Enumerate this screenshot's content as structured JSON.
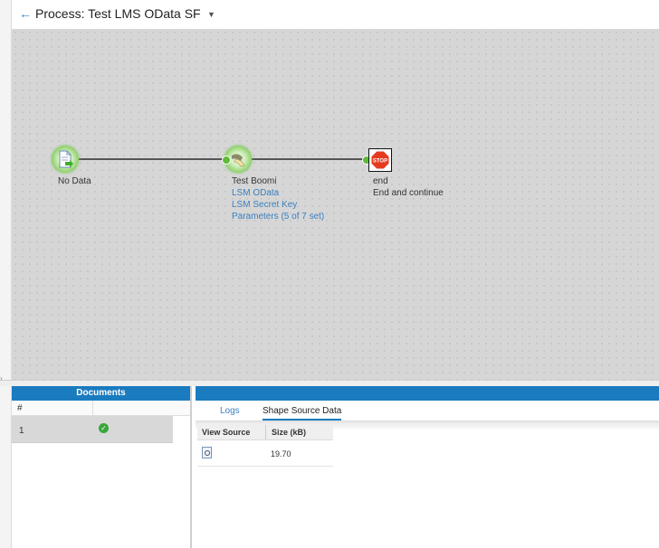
{
  "header": {
    "title": "Process: Test LMS OData SF"
  },
  "canvas": {
    "nodes": [
      {
        "title": "No Data",
        "lines": []
      },
      {
        "title": "Test Boomi",
        "lines": [
          "LSM OData",
          "LSM Secret Key",
          "Parameters (5 of 7 set)"
        ]
      },
      {
        "title": "end",
        "lines": [
          "End and continue"
        ]
      }
    ],
    "stop_text": "STOP"
  },
  "documents": {
    "title": "Documents",
    "col_num": "#",
    "rows": [
      {
        "num": "1",
        "status": "ok"
      }
    ]
  },
  "detail": {
    "tabs": [
      {
        "label": "Logs"
      },
      {
        "label": "Shape Source Data"
      }
    ],
    "columns": [
      "View Source",
      "Size (kB)"
    ],
    "rows": [
      {
        "size": "19.70"
      }
    ]
  },
  "colors": {
    "accent": "#1b7bbf",
    "link": "#3a7fc0",
    "canvas": "#d6d6d6"
  }
}
